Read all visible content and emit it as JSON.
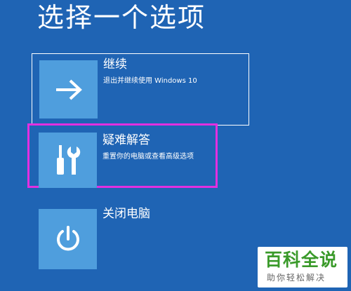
{
  "page": {
    "title": "选择一个选项"
  },
  "options": [
    {
      "label": "继续",
      "description": "退出并继续使用 Windows 10",
      "icon": "arrow-right-icon"
    },
    {
      "label": "疑难解答",
      "description": "重置你的电脑或查看高级选项",
      "icon": "screwdriver-wrench-icon",
      "highlighted": true
    },
    {
      "label": "关闭电脑",
      "icon": "power-icon"
    }
  ],
  "watermark": {
    "title": "百科全说",
    "subtitle": "助你轻松解决"
  },
  "colors": {
    "background": "#1f64b4",
    "tile": "#4f9edd",
    "highlight_border": "#e32fe0",
    "watermark_green": "#3a9a2a"
  }
}
